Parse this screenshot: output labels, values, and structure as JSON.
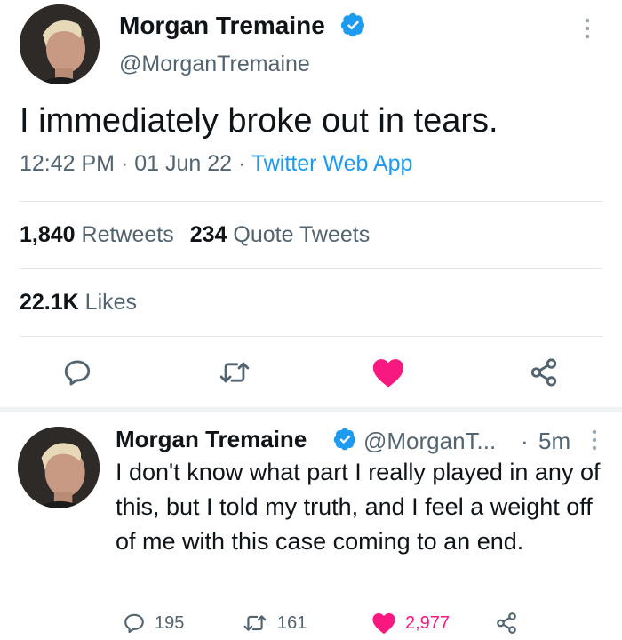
{
  "tweet": {
    "author_name": "Morgan Tremaine",
    "author_handle": "@MorganTremaine",
    "text": "I immediately broke out in tears.",
    "time": "12:42 PM",
    "dot": "·",
    "date": "01 Jun 22",
    "source": "Twitter Web App",
    "retweets_count": "1,840",
    "retweets_label": "Retweets",
    "quotes_count": "234",
    "quotes_label": "Quote Tweets",
    "likes_count": "22.1K",
    "likes_label": "Likes",
    "liked": true
  },
  "reply": {
    "author_name": "Morgan Tremaine",
    "author_handle": "@MorganT...",
    "dot": "·",
    "time": "5m",
    "text": "I don't know what part I really played in any of this, but I told my truth, and I feel a weight off of me with this case coming to an end.",
    "replies": "195",
    "retweets": "161",
    "likes": "2,977",
    "liked": true
  },
  "icons": {
    "verified": "verified-badge-icon",
    "more": "more-vertical-icon",
    "reply": "reply-icon",
    "retweet": "retweet-icon",
    "like": "heart-icon",
    "share": "share-icon"
  },
  "colors": {
    "accent": "#1d9bf0",
    "like": "#f91880",
    "text": "#0f1419",
    "muted": "#536471"
  }
}
